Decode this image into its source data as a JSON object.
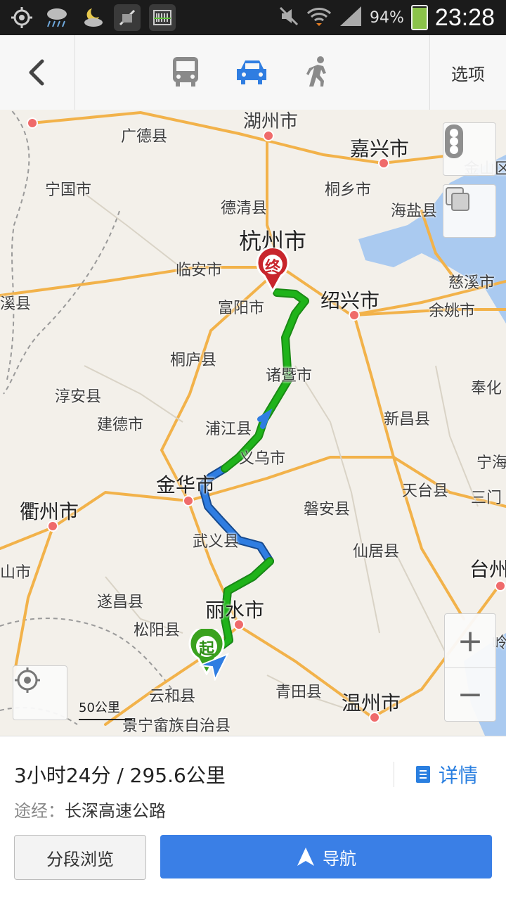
{
  "status_bar": {
    "battery": "94%",
    "battery_level": 0.94,
    "time": "23:28",
    "icons": [
      "gps-icon",
      "rain-weather-icon",
      "night-weather-icon",
      "muted-app-icon",
      "barcode-app-icon",
      "mute-icon",
      "wifi-icon",
      "signal-icon",
      "battery-charging-icon"
    ]
  },
  "header": {
    "back_icon": "back-arrow-icon",
    "modes": [
      {
        "name": "bus",
        "icon": "bus-icon",
        "active": false
      },
      {
        "name": "car",
        "icon": "car-icon",
        "active": true
      },
      {
        "name": "walk",
        "icon": "walk-icon",
        "active": false
      }
    ],
    "options_label": "选项",
    "active_color": "#2f7de1",
    "inactive_color": "#8a8a8a"
  },
  "map": {
    "cities": {
      "huzhou": "湖州市",
      "guangde": "广德县",
      "jiaxing": "嘉兴市",
      "jinshan": "金山区",
      "ningguo": "宁国市",
      "tongxiang": "桐乡市",
      "deqing": "德清县",
      "haiyan": "海盐县",
      "hangzhou": "杭州市",
      "linan": "临安市",
      "xixian": "溪县",
      "fuyang": "富阳市",
      "shaoxing": "绍兴市",
      "cixi": "慈溪市",
      "yuyao": "余姚市",
      "tonglu": "桐庐县",
      "zhuji": "诸暨市",
      "chunan": "淳安县",
      "fenghua": "奉化",
      "jiande": "建德市",
      "pujiang": "浦江县",
      "xinchang": "新昌县",
      "yiwu": "义乌市",
      "ninghai": "宁海",
      "jinhua": "金华市",
      "tiantai": "天台县",
      "sanmen": "三门",
      "quzhou": "衢州市",
      "panan": "磐安县",
      "wuyi": "武义县",
      "xianju": "仙居县",
      "taizhou": "台州",
      "jiangshan": "山市",
      "suichang": "遂昌县",
      "lishui": "丽水市",
      "songyang": "松阳县",
      "yunhe": "云和县",
      "qingtian": "青田县",
      "wenzhou": "温州市",
      "jingning": "景宁畲族自治县",
      "ling": "岭"
    },
    "start_marker": "起",
    "end_marker": "终",
    "scale_label": "50公里",
    "controls": {
      "traffic_icon": "traffic-light-icon",
      "layers_icon": "layers-icon",
      "zoom_in": "+",
      "zoom_out": "−",
      "locate_icon": "locate-icon"
    },
    "route_colors": {
      "green": "#1fb31a",
      "blue": "#2f7de1"
    }
  },
  "route_panel": {
    "summary": "3小时24分 / 295.6公里",
    "via_label": "途经：",
    "via_road": "长深高速公路",
    "details_label": "详情",
    "details_icon": "list-detail-icon",
    "segment_button": "分段浏览",
    "navigate_button": "导航",
    "navigate_icon": "navigation-arrow-icon"
  }
}
